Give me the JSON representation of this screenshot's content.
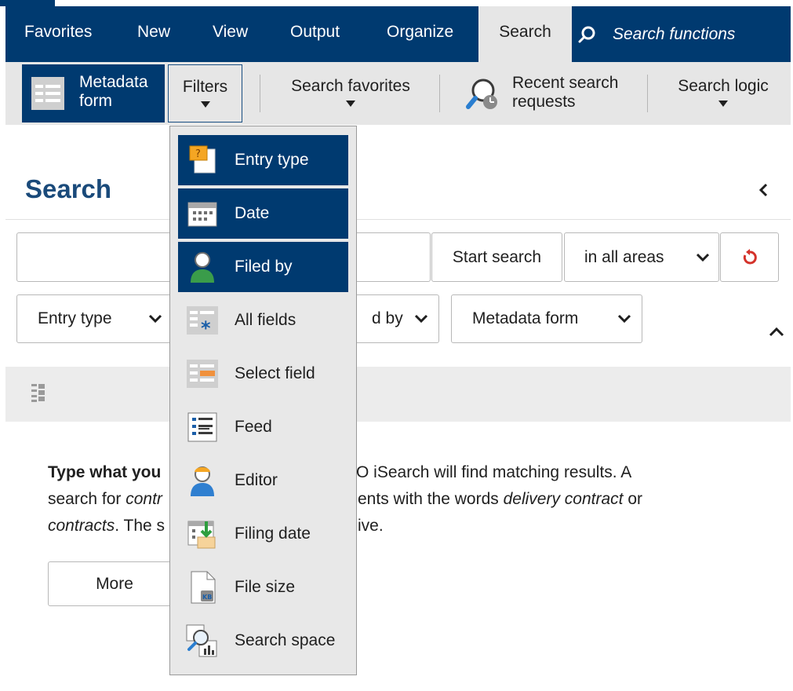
{
  "menu": {
    "items": [
      {
        "label": "Favorites"
      },
      {
        "label": "New"
      },
      {
        "label": "View"
      },
      {
        "label": "Output"
      },
      {
        "label": "Organize"
      },
      {
        "label": "Search"
      }
    ],
    "search_functions_placeholder": "Search functions"
  },
  "ribbon": {
    "metadata_form": "Metadata form",
    "filters": "Filters",
    "search_favorites": "Search favorites",
    "recent_search_requests": "Recent search requests",
    "search_logic": "Search logic"
  },
  "search": {
    "heading": "Search",
    "start_button": "Start search",
    "scope": "in all areas",
    "filters": {
      "entry_type": "Entry type",
      "filed_by_partial": "d by",
      "metadata_form": "Metadata form"
    },
    "help": {
      "bold_start": "Type what you",
      "line1_end": "O iSearch will find matching results. A",
      "line2_start": "search for ",
      "line2_italic": "contr",
      "line2_mid": "ents with the words ",
      "line2_italic2": "delivery contract",
      "line2_end": " or",
      "line3_italic": "contracts",
      "line3_mid": ". The s",
      "line3_end": "ive."
    },
    "more_button": "More"
  },
  "filters_menu": {
    "items": [
      {
        "label": "Entry type",
        "icon": "entry-type-icon",
        "selected": true
      },
      {
        "label": "Date",
        "icon": "calendar-icon",
        "selected": true
      },
      {
        "label": "Filed by",
        "icon": "person-icon",
        "selected": true
      },
      {
        "label": "All fields",
        "icon": "all-fields-icon",
        "selected": false
      },
      {
        "label": "Select field",
        "icon": "select-field-icon",
        "selected": false
      },
      {
        "label": "Feed",
        "icon": "feed-icon",
        "selected": false
      },
      {
        "label": "Editor",
        "icon": "editor-icon",
        "selected": false
      },
      {
        "label": "Filing date",
        "icon": "filing-date-icon",
        "selected": false
      },
      {
        "label": "File size",
        "icon": "file-size-icon",
        "selected": false
      },
      {
        "label": "Search space",
        "icon": "search-space-icon",
        "selected": false
      }
    ]
  },
  "colors": {
    "brand_blue": "#003a70",
    "ribbon_gray": "#e6e6e6",
    "reset_red": "#d4322a"
  }
}
